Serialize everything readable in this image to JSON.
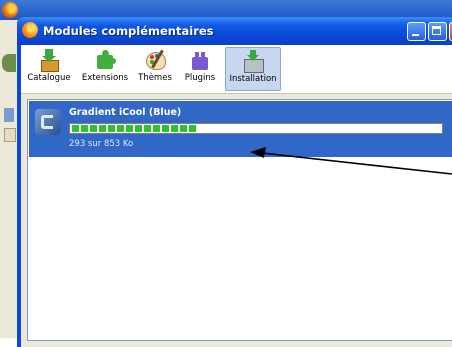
{
  "dialog": {
    "title": "Modules complémentaires"
  },
  "toolbar": {
    "items": [
      {
        "label": "Catalogue",
        "icon": "catalog-icon"
      },
      {
        "label": "Extensions",
        "icon": "puzzle-icon"
      },
      {
        "label": "Thèmes",
        "icon": "palette-icon"
      },
      {
        "label": "Plugins",
        "icon": "plugin-icon"
      },
      {
        "label": "Installation",
        "icon": "install-icon",
        "active": true
      }
    ]
  },
  "download": {
    "name": "Gradient iCool (Blue)",
    "status": "293 sur 853 Ko",
    "progress": 0.34
  },
  "colors": {
    "titlebar": "#0a48d6",
    "selection": "#3168c8",
    "progress": "#2bc42b",
    "annotation": "#000000"
  }
}
